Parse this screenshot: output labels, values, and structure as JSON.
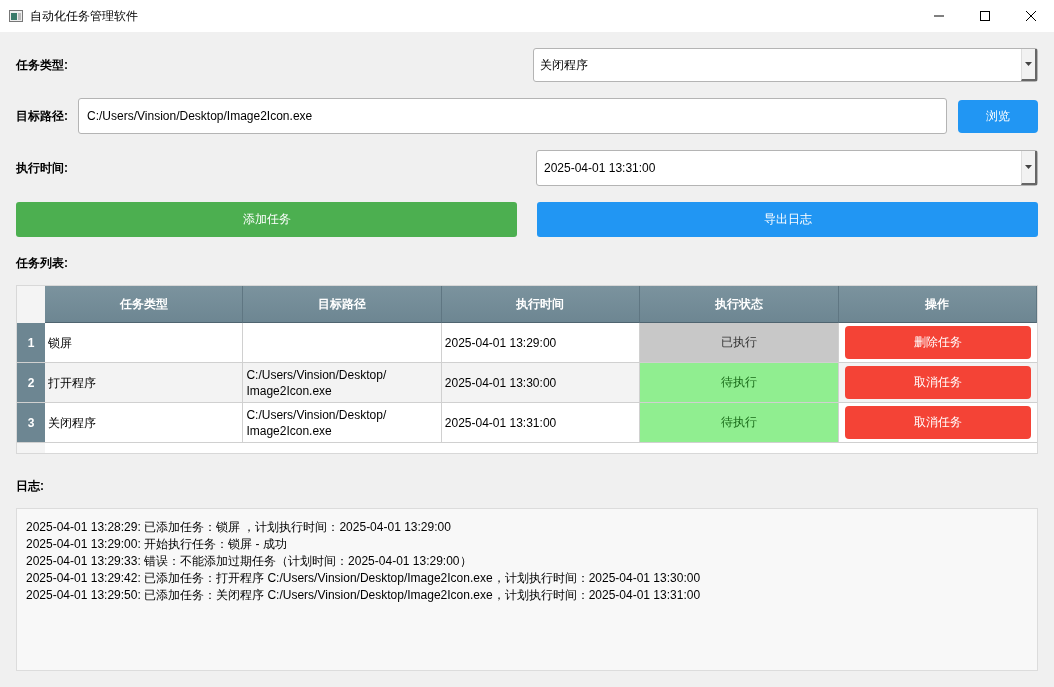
{
  "window": {
    "title": "自动化任务管理软件"
  },
  "form": {
    "task_type": {
      "label": "任务类型:",
      "value": "关闭程序"
    },
    "target_path": {
      "label": "目标路径:",
      "value": "C:/Users/Vinsion/Desktop/Image2Icon.exe",
      "button": "浏览"
    },
    "exec_time": {
      "label": "执行时间:",
      "value": "2025-04-01 13:31:00"
    }
  },
  "actions": [
    {
      "label": "添加任务",
      "kind": "add"
    },
    {
      "label": "导出日志",
      "kind": "export"
    }
  ],
  "task_list": {
    "title": "任务列表:",
    "columns": [
      "任务类型",
      "目标路径",
      "执行时间",
      "执行状态",
      "操作"
    ],
    "rows": [
      {
        "index": "1",
        "type": "锁屏",
        "path": "",
        "time": "2025-04-01 13:29:00",
        "status": "已执行",
        "executed": true,
        "action": "删除任务"
      },
      {
        "index": "2",
        "type": "打开程序",
        "path": "C:/Users/Vinsion/Desktop/ Image2Icon.exe",
        "time": "2025-04-01 13:30:00",
        "status": "待执行",
        "executed": false,
        "action": "取消任务"
      },
      {
        "index": "3",
        "type": "关闭程序",
        "path": "C:/Users/Vinsion/Desktop/ Image2Icon.exe",
        "time": "2025-04-01 13:31:00",
        "status": "待执行",
        "executed": false,
        "action": "取消任务"
      }
    ]
  },
  "log": {
    "title": "日志:",
    "lines": [
      "2025-04-01 13:28:29: 已添加任务：锁屏 ，计划执行时间：2025-04-01 13:29:00",
      "2025-04-01 13:29:00: 开始执行任务：锁屏  - 成功",
      "2025-04-01 13:29:33: 错误：不能添加过期任务（计划时间：2025-04-01 13:29:00）",
      "2025-04-01 13:29:42: 已添加任务：打开程序 C:/Users/Vinsion/Desktop/Image2Icon.exe，计划执行时间：2025-04-01 13:30:00",
      "2025-04-01 13:29:50: 已添加任务：关闭程序 C:/Users/Vinsion/Desktop/Image2Icon.exe，计划执行时间：2025-04-01 13:31:00"
    ]
  }
}
